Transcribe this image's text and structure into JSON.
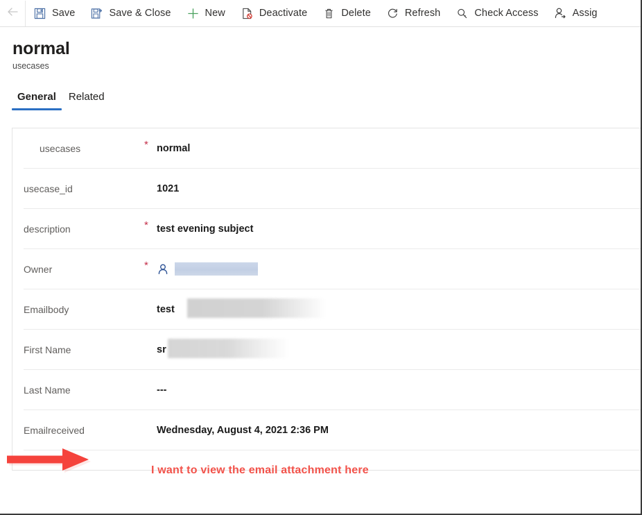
{
  "commandbar": {
    "back_icon": "arrow-left-icon",
    "items": [
      {
        "label": "Save",
        "icon": "save-icon"
      },
      {
        "label": "Save & Close",
        "icon": "save-and-close-icon"
      },
      {
        "label": "New",
        "icon": "plus-icon"
      },
      {
        "label": "Deactivate",
        "icon": "deactivate-icon"
      },
      {
        "label": "Delete",
        "icon": "trash-icon"
      },
      {
        "label": "Refresh",
        "icon": "refresh-icon"
      },
      {
        "label": "Check Access",
        "icon": "key-icon"
      },
      {
        "label": "Assig",
        "icon": "assign-user-icon"
      }
    ]
  },
  "header": {
    "title": "normal",
    "subtitle": "usecases"
  },
  "tabs": [
    {
      "label": "General",
      "active": true
    },
    {
      "label": "Related",
      "active": false
    }
  ],
  "form": {
    "rows": [
      {
        "label": "usecases",
        "required": true,
        "value": "normal",
        "redaction": "none"
      },
      {
        "label": "usecase_id",
        "required": false,
        "value": "1021",
        "redaction": "none"
      },
      {
        "label": "description",
        "required": true,
        "value": "test evening subject",
        "redaction": "none"
      },
      {
        "label": "Owner",
        "required": true,
        "value": "",
        "redaction": "blue-box",
        "icon": "person-icon"
      },
      {
        "label": "Emailbody",
        "required": false,
        "value": "test ",
        "redaction": "gray-blur"
      },
      {
        "label": "First Name",
        "required": false,
        "value": "sr",
        "redaction": "gray-blur"
      },
      {
        "label": "Last Name",
        "required": false,
        "value": "---",
        "redaction": "none"
      },
      {
        "label": "Emailreceived",
        "required": false,
        "value": "Wednesday, August 4, 2021 2:36 PM",
        "redaction": "none"
      }
    ]
  },
  "annotation": {
    "text": "I want to view the email attachment here",
    "arrow": "right-arrow-annotation",
    "color": "#f2524a"
  },
  "colors": {
    "accent": "#2b6fc3",
    "required_asterisk": "#c4314b",
    "annotation_red": "#f2524a",
    "label_gray": "#605e5c",
    "owner_redaction": "#c2cfe4"
  }
}
